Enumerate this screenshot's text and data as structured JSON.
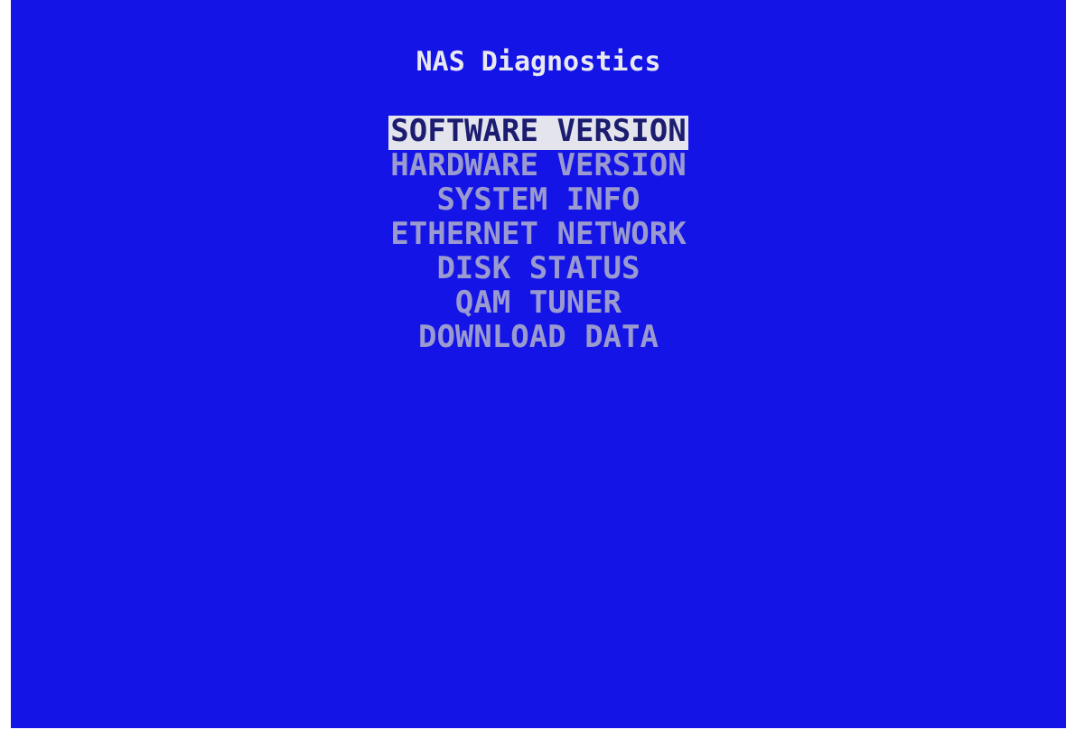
{
  "title": "NAS Diagnostics",
  "menu": [
    {
      "label": "SOFTWARE VERSION",
      "selected": true
    },
    {
      "label": "HARDWARE VERSION",
      "selected": false
    },
    {
      "label": "SYSTEM INFO",
      "selected": false
    },
    {
      "label": "ETHERNET NETWORK",
      "selected": false
    },
    {
      "label": "DISK STATUS",
      "selected": false
    },
    {
      "label": "QAM TUNER",
      "selected": false
    },
    {
      "label": "DOWNLOAD DATA",
      "selected": false
    }
  ]
}
